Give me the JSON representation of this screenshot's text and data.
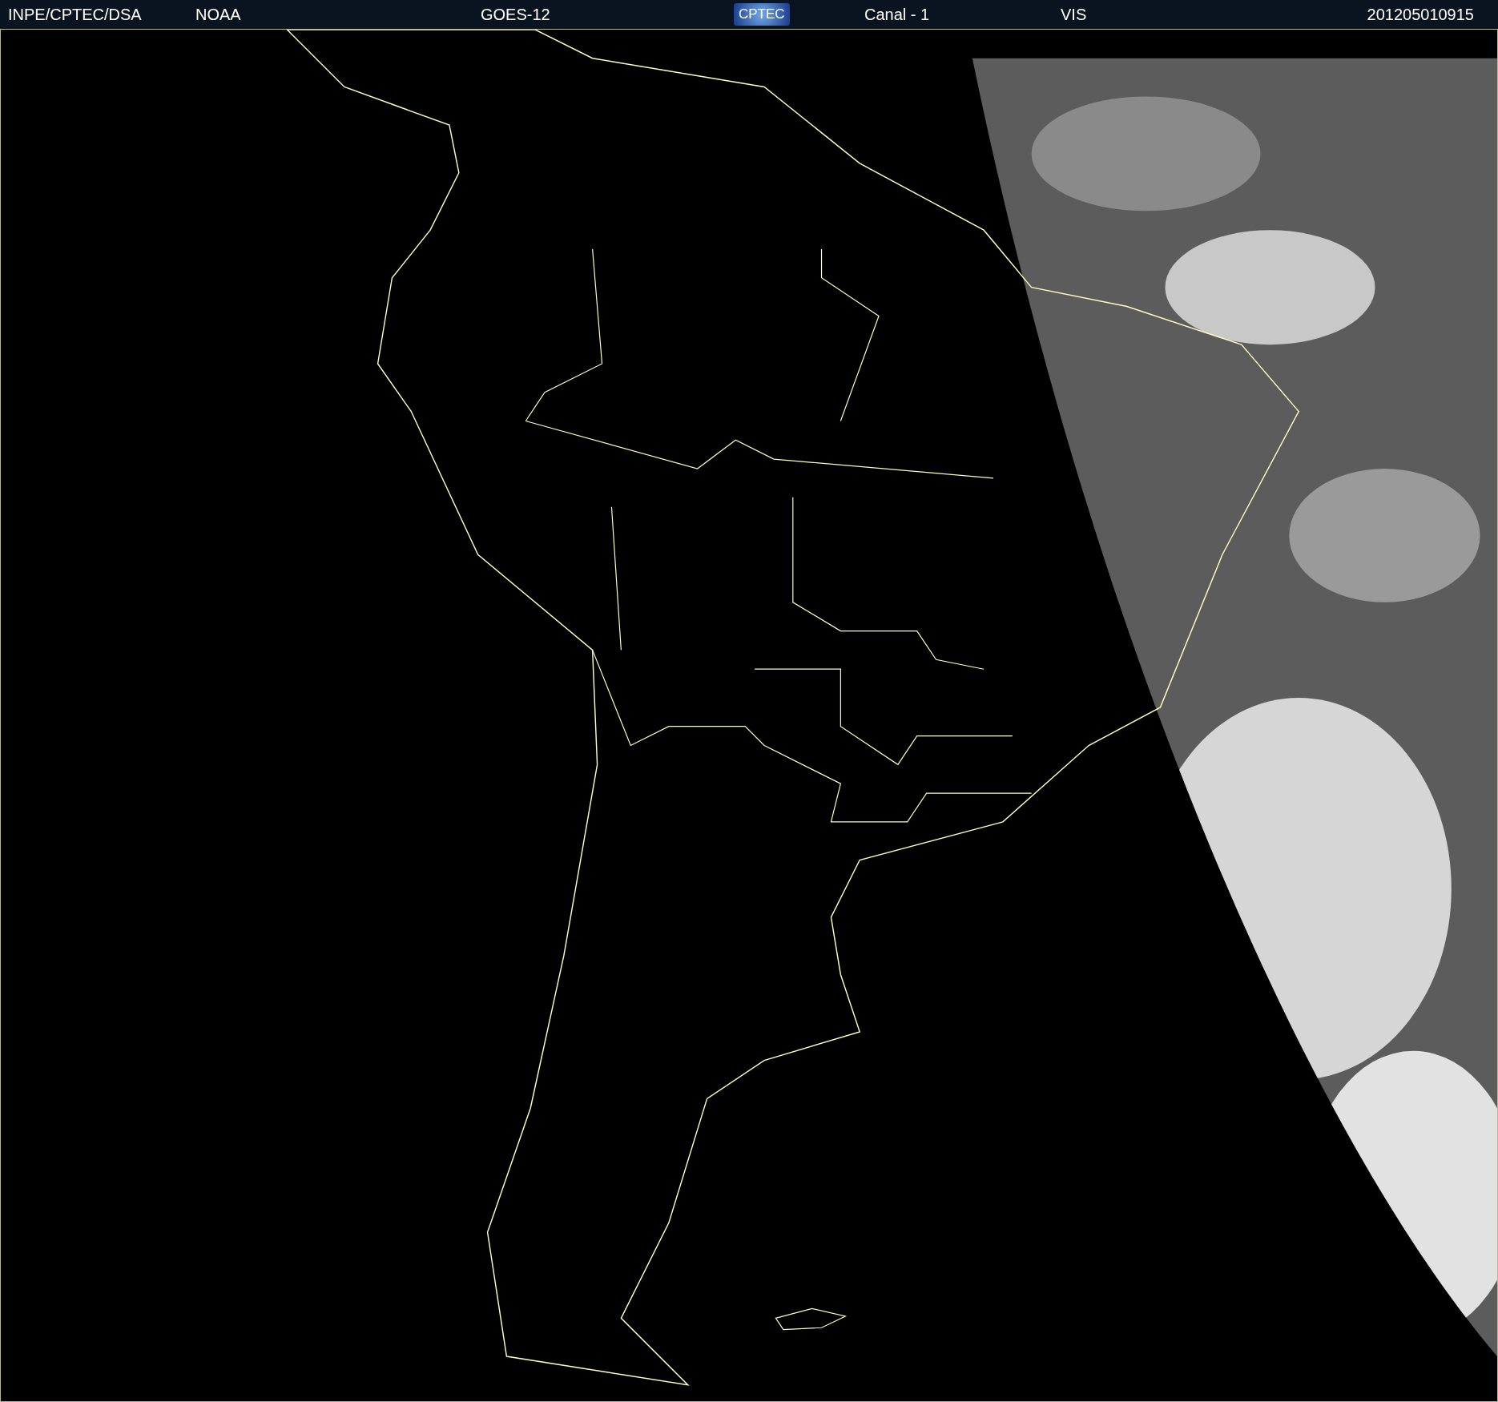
{
  "header": {
    "items": [
      {
        "kind": "text",
        "text": "INPE/CPTEC/DSA"
      },
      {
        "kind": "text",
        "text": "NOAA"
      },
      {
        "kind": "text",
        "text": "GOES-12"
      },
      {
        "kind": "logo",
        "text": "CPTEC"
      },
      {
        "kind": "text",
        "text": "Canal - 1"
      },
      {
        "kind": "text",
        "text": "VIS"
      },
      {
        "kind": "spacer"
      },
      {
        "kind": "text",
        "text": "201205010915"
      }
    ]
  }
}
